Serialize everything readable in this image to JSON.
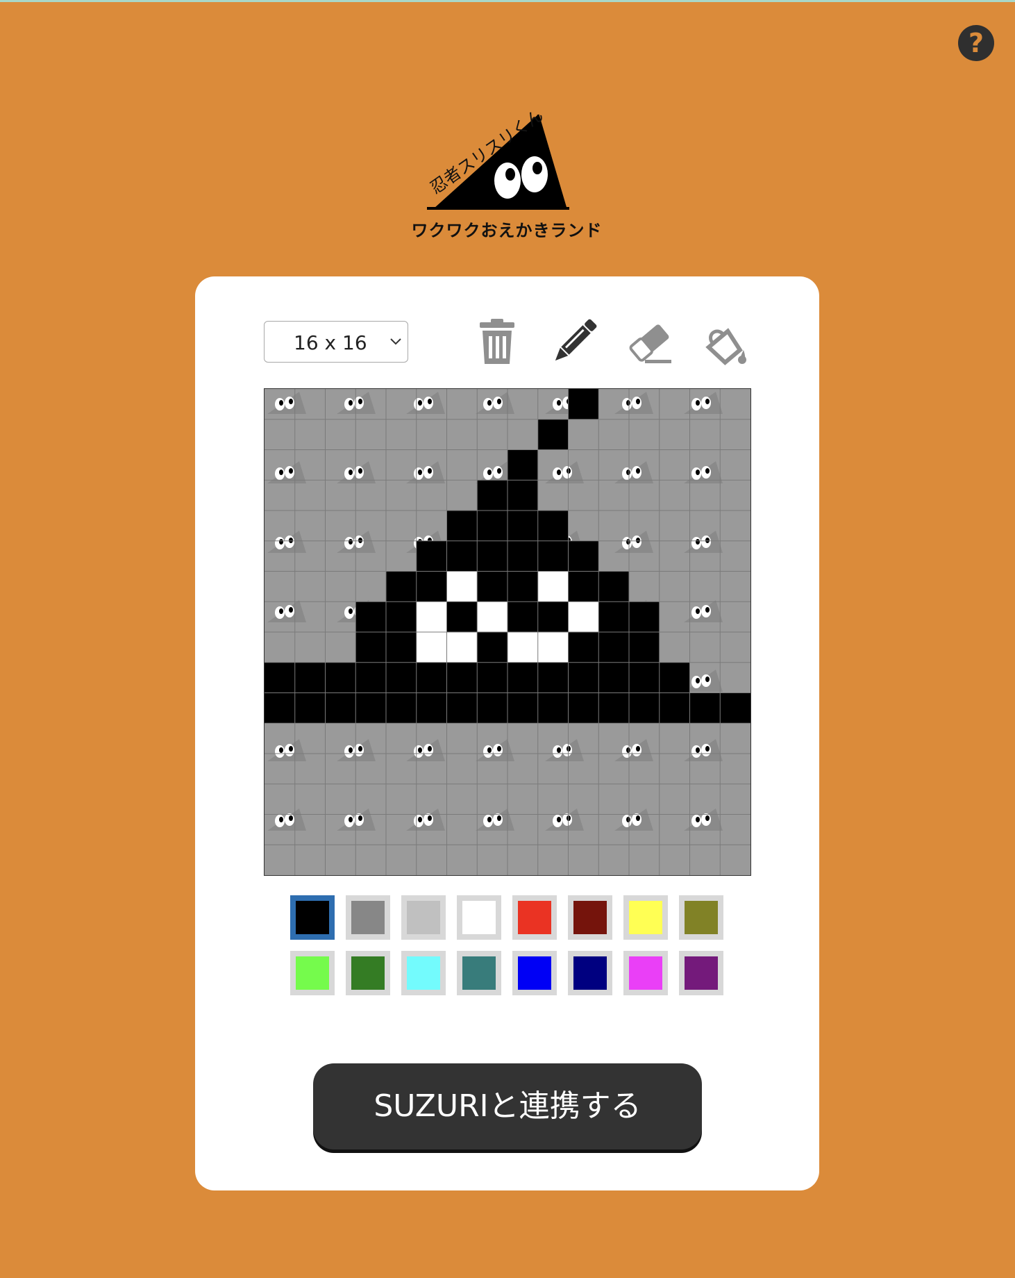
{
  "app": {
    "logo_title": "忍者スリスリくん",
    "logo_subtitle": "ワクワクおえかきランド",
    "help_label": "?"
  },
  "toolbar": {
    "canvas_size": "16 x 16",
    "tools": [
      {
        "name": "trash-icon"
      },
      {
        "name": "pencil-icon"
      },
      {
        "name": "eraser-icon"
      },
      {
        "name": "paint-bucket-icon"
      }
    ],
    "active_tool": "pencil"
  },
  "canvas": {
    "grid_size": 16,
    "pattern_rows": [
      "0000000000100000",
      "0000000001000000",
      "0000000010000000",
      "0000000110000000",
      "0000001111000000",
      "0000011111100000",
      "0000112112110000",
      "0001121211211000",
      "0001122122111000",
      "1111111111111100",
      "1111111111111111",
      "0000000000000000",
      "0000000000000000",
      "0000000000000000",
      "0000000000000000",
      "0000000000000000"
    ],
    "colors": {
      "empty": "#9a9a9a",
      "black": "#000000",
      "white": "#ffffff"
    }
  },
  "palette": {
    "selected_index": 0,
    "colors": [
      "#000000",
      "#878787",
      "#c0c0c0",
      "#ffffff",
      "#ea3323",
      "#75140c",
      "#ffff54",
      "#818226",
      "#75fb4c",
      "#347c24",
      "#73fbfd",
      "#387c7b",
      "#0000f5",
      "#000080",
      "#ea3ff7",
      "#741a7b"
    ]
  },
  "actions": {
    "suzuri_label": "SUZURIと連携する"
  },
  "theme": {
    "background": "#db8b3a",
    "panel": "#ffffff",
    "button": "#333333"
  }
}
